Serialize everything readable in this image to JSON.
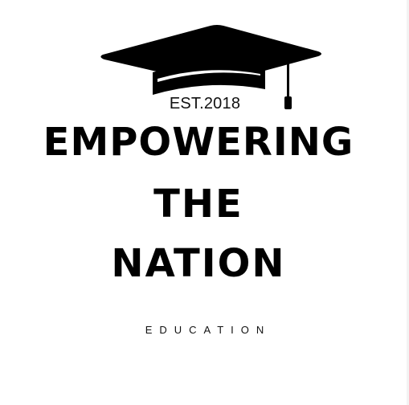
{
  "logo": {
    "icon": "graduation-cap-icon",
    "established": "EST.2018",
    "title_lines": [
      "EMPOWERING",
      "THE",
      "NATION"
    ],
    "tagline": "EDUCATION"
  },
  "colors": {
    "background": "#ffffff",
    "ink": "#000000"
  }
}
